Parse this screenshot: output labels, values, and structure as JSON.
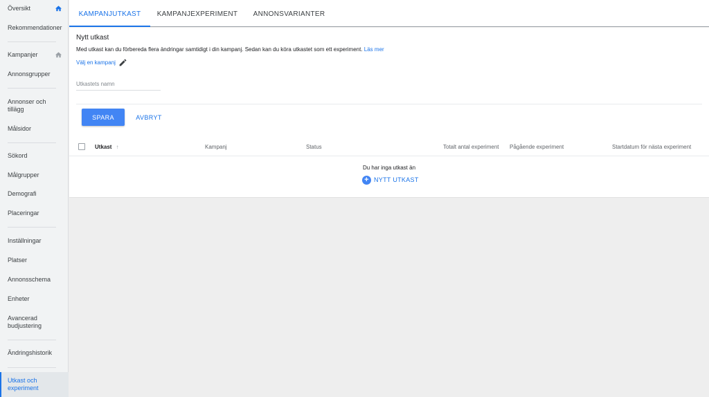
{
  "sidebar": {
    "items": [
      {
        "label": "Översikt"
      },
      {
        "label": "Rekommendationer"
      },
      {
        "label": "Kampanjer"
      },
      {
        "label": "Annonsgrupper"
      },
      {
        "label": "Annonser och tillägg"
      },
      {
        "label": "Målsidor"
      },
      {
        "label": "Sökord"
      },
      {
        "label": "Målgrupper"
      },
      {
        "label": "Demografi"
      },
      {
        "label": "Placeringar"
      },
      {
        "label": "Inställningar"
      },
      {
        "label": "Platser"
      },
      {
        "label": "Annonsschema"
      },
      {
        "label": "Enheter"
      },
      {
        "label": "Avancerad budjustering"
      },
      {
        "label": "Ändringshistorik"
      },
      {
        "label": "Utkast och experiment"
      }
    ],
    "active_index": 16,
    "home_icon": "home-icon"
  },
  "tabs": [
    {
      "label": "KAMPANJUTKAST"
    },
    {
      "label": "KAMPANJEXPERIMENT"
    },
    {
      "label": "ANNONSVARIANTER"
    }
  ],
  "draft": {
    "title": "Nytt utkast",
    "description": "Med utkast kan du förbereda flera ändringar samtidigt i din kampanj. Sedan kan du köra utkastet som ett experiment. ",
    "learn_more": "Läs mer",
    "choose_campaign": "Välj en kampanj",
    "name_placeholder": "Utkastets namn",
    "save_label": "SPARA",
    "cancel_label": "AVBRYT"
  },
  "table": {
    "columns": [
      {
        "label": "Utkast"
      },
      {
        "label": "Kampanj"
      },
      {
        "label": "Status"
      },
      {
        "label": "Totalt antal experiment"
      },
      {
        "label": "Pågående experiment"
      },
      {
        "label": "Startdatum för nästa experiment"
      }
    ],
    "sort_icon": "↑",
    "empty_text": "Du har inga utkast än",
    "new_draft_label": "NYTT UTKAST"
  },
  "colors": {
    "accent": "#1a73e8",
    "button": "#4285f4"
  }
}
